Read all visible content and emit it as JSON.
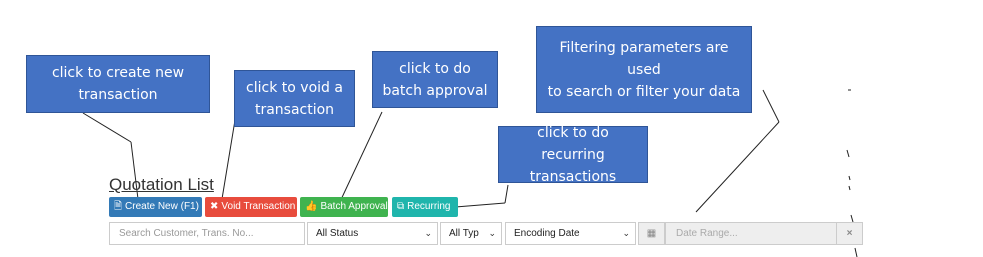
{
  "callouts": {
    "create": {
      "lines": [
        "click to create new",
        "transaction"
      ]
    },
    "void": {
      "lines": [
        "click to void a",
        "transaction"
      ]
    },
    "batch": {
      "lines": [
        "click to do",
        "batch approval"
      ]
    },
    "filter": {
      "lines": [
        "Filtering parameters are used",
        "to search or filter your data"
      ]
    },
    "recurring": {
      "lines": [
        "click to do recurring",
        "transactions"
      ]
    }
  },
  "page": {
    "title": "Quotation List"
  },
  "toolbar": {
    "create_label": "Create New (F1)",
    "void_label": "Void Transaction",
    "batch_label": "Batch Approval",
    "recurring_label": "Recurring"
  },
  "filters": {
    "search_placeholder": "Search Customer, Trans. No...",
    "status_selected": "All Status",
    "type_selected": "All Typ",
    "date_field_selected": "Encoding Date",
    "date_range_placeholder": "Date Range...",
    "clear_symbol": "×"
  },
  "colors": {
    "callout_fill": "#4472c4",
    "create_button": "#337ab7",
    "void_button": "#e84c3d",
    "batch_button": "#3fb34f",
    "recurring_button": "#1fb5ac"
  },
  "icons": {
    "create": "file-icon",
    "void": "close-icon",
    "batch": "thumbs-up-icon",
    "recurring": "copy-icon",
    "calendar": "calendar-icon",
    "caret": "chevron-down-icon"
  }
}
